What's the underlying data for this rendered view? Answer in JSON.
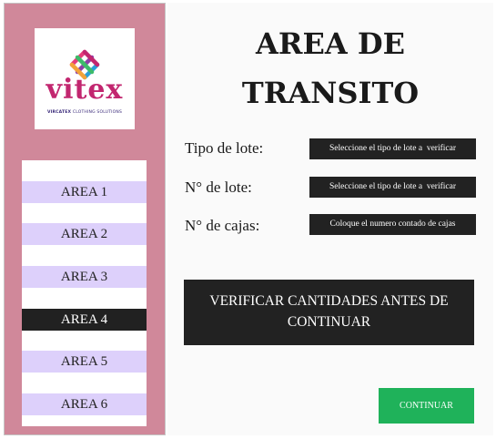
{
  "logo": {
    "wordmark": "vitex",
    "tagline_bold": "VIRCATEX",
    "tagline_rest": " CLOTHING SOLUTIONS",
    "colors": [
      "#e63b7a",
      "#8e3fa8",
      "#2a9fd8",
      "#f2a23a",
      "#3dbb6a"
    ]
  },
  "sidebar": {
    "items": [
      {
        "label": "AREA 1",
        "active": false
      },
      {
        "label": "AREA 2",
        "active": false
      },
      {
        "label": "AREA 3",
        "active": false
      },
      {
        "label": "AREA 4",
        "active": true
      },
      {
        "label": "AREA 5",
        "active": false
      },
      {
        "label": "AREA 6",
        "active": false
      }
    ]
  },
  "main": {
    "title": "AREA DE TRANSITO",
    "fields": [
      {
        "label": "Tipo de lote:",
        "value": "Seleccione el tipo de lote a  verificar"
      },
      {
        "label": "N° de lote:",
        "value": "Seleccione el tipo de lote a  verificar"
      },
      {
        "label": "N° de cajas:",
        "value": "Coloque el numero contado de cajas"
      }
    ],
    "verify_message": "VERIFICAR CANTIDADES ANTES DE CONTINUAR",
    "continue_label": "CONTINUAR"
  },
  "colors": {
    "sidebar": "#d0889a",
    "area_item": "#ddd0fb",
    "area_active": "#212121",
    "dark_panel": "#222222",
    "continue": "#1fb25a"
  }
}
